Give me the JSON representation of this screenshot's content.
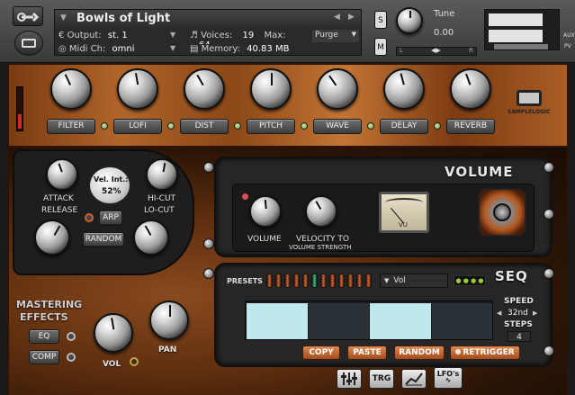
{
  "header": {
    "instrument_name": "Bowls of Light",
    "output_label": "Output:",
    "output_value": "st. 1",
    "midi_label": "Midi Ch:",
    "midi_value": "omni",
    "voices_label": "Voices:",
    "voices_value": "19",
    "max_label": "Max:",
    "max_value": "64",
    "purge_label": "Purge",
    "memory_label": "Memory:",
    "memory_value": "40.83 MB",
    "s_label": "S",
    "m_label": "M",
    "tune_label": "Tune",
    "tune_value": "0.00",
    "pan_left": "L",
    "pan_right": "R",
    "aux_label": "AUX",
    "pv_label": "PV"
  },
  "fx_bar": {
    "items": [
      {
        "label": "FILTER"
      },
      {
        "label": "LOFI"
      },
      {
        "label": "DIST"
      },
      {
        "label": "PITCH"
      },
      {
        "label": "WAVE"
      },
      {
        "label": "DELAY"
      },
      {
        "label": "REVERB"
      }
    ],
    "logo_text": "SAMPLELOGIC"
  },
  "left_panel": {
    "attack_label": "ATTACK",
    "release_label": "RELEASE",
    "vel_int_label": "Vel. Int.:",
    "vel_int_value": "52%",
    "hicut_label": "HI-CUT",
    "locut_label": "LO-CUT",
    "arp_label": "ARP",
    "random_label": "RANDOM",
    "mastering_line1": "MASTERING",
    "mastering_line2": "EFFECTS",
    "eq_label": "EQ",
    "comp_label": "COMP",
    "vol_label": "VOL",
    "pan_label": "PAN"
  },
  "volume_panel": {
    "title": "VOLUME",
    "volume_label": "VOLUME",
    "velocity_label": "VELOCITY TO",
    "velocity_sub": "VOLUME STRENGTH",
    "vu_label": "VU"
  },
  "seq_panel": {
    "title": "SEQ",
    "presets_label": "PRESETS",
    "preset_value": "Vol",
    "preset_arrow": "▼",
    "speed_label": "SPEED",
    "speed_value": "32nd",
    "steps_label": "STEPS",
    "steps_value": "4",
    "copy_label": "COPY",
    "paste_label": "PASTE",
    "random_label": "RANDOM",
    "retrigger_label": "RETRIGGER",
    "step_values": [
      1,
      0,
      1,
      0
    ],
    "tube_count": 12,
    "active_tube": 5
  },
  "bottom_tabs": {
    "trg_label": "TRG",
    "lfo_label": "LFO's"
  },
  "colors": {
    "seq_step_on": "#bfe8ec",
    "seq_step_off": "#2a3136",
    "accent_orange": "#d5763c"
  }
}
